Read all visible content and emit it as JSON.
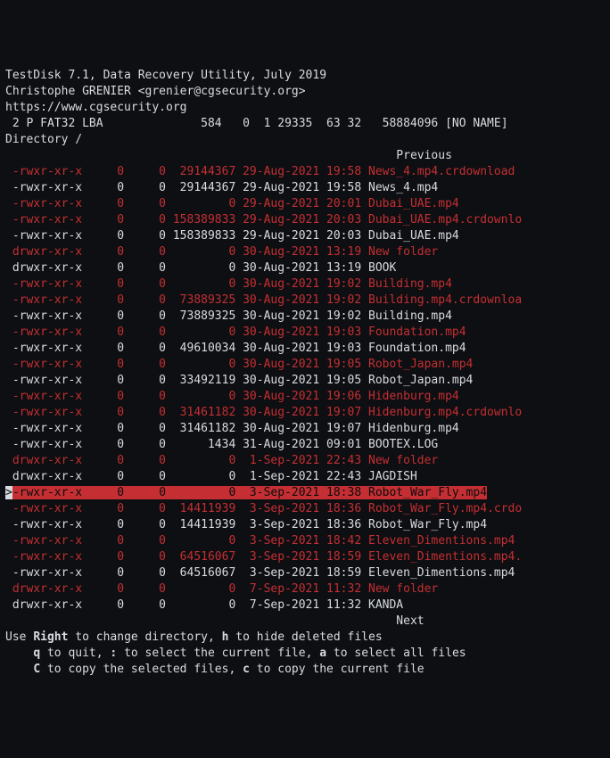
{
  "header": {
    "title": "TestDisk 7.1, Data Recovery Utility, July 2019",
    "author": "Christophe GRENIER <grenier@cgsecurity.org>",
    "url": "https://www.cgsecurity.org"
  },
  "partition": {
    "index": " 2",
    "status": "P",
    "type": "FAT32 LBA",
    "chs_start": "584",
    "chs_start_h": "0",
    "chs_start_s": "1",
    "chs_end": "29335",
    "chs_end_h": "63",
    "chs_end_s": "32",
    "sectors": "58884096",
    "label": "[NO NAME]"
  },
  "directory_label": "Directory /",
  "nav": {
    "previous": "Previous",
    "next": "Next"
  },
  "rows": [
    {
      "cls": "red",
      "perm": "-rwxr-xr-x",
      "uid": "0",
      "gid": "0",
      "size": "29144367",
      "date": "29-Aug-2021",
      "time": "19:58",
      "name": "News_4.mp4.crdownload"
    },
    {
      "cls": "white",
      "perm": "-rwxr-xr-x",
      "uid": "0",
      "gid": "0",
      "size": "29144367",
      "date": "29-Aug-2021",
      "time": "19:58",
      "name": "News_4.mp4"
    },
    {
      "cls": "red",
      "perm": "-rwxr-xr-x",
      "uid": "0",
      "gid": "0",
      "size": "0",
      "date": "29-Aug-2021",
      "time": "20:01",
      "name": "Dubai_UAE.mp4"
    },
    {
      "cls": "red",
      "perm": "-rwxr-xr-x",
      "uid": "0",
      "gid": "0",
      "size": "158389833",
      "date": "29-Aug-2021",
      "time": "20:03",
      "name": "Dubai_UAE.mp4.crdownlo"
    },
    {
      "cls": "white",
      "perm": "-rwxr-xr-x",
      "uid": "0",
      "gid": "0",
      "size": "158389833",
      "date": "29-Aug-2021",
      "time": "20:03",
      "name": "Dubai_UAE.mp4"
    },
    {
      "cls": "red",
      "perm": "drwxr-xr-x",
      "uid": "0",
      "gid": "0",
      "size": "0",
      "date": "30-Aug-2021",
      "time": "13:19",
      "name": "New folder"
    },
    {
      "cls": "white",
      "perm": "drwxr-xr-x",
      "uid": "0",
      "gid": "0",
      "size": "0",
      "date": "30-Aug-2021",
      "time": "13:19",
      "name": "BOOK"
    },
    {
      "cls": "red",
      "perm": "-rwxr-xr-x",
      "uid": "0",
      "gid": "0",
      "size": "0",
      "date": "30-Aug-2021",
      "time": "19:02",
      "name": "Building.mp4"
    },
    {
      "cls": "red",
      "perm": "-rwxr-xr-x",
      "uid": "0",
      "gid": "0",
      "size": "73889325",
      "date": "30-Aug-2021",
      "time": "19:02",
      "name": "Building.mp4.crdownloa"
    },
    {
      "cls": "white",
      "perm": "-rwxr-xr-x",
      "uid": "0",
      "gid": "0",
      "size": "73889325",
      "date": "30-Aug-2021",
      "time": "19:02",
      "name": "Building.mp4"
    },
    {
      "cls": "red",
      "perm": "-rwxr-xr-x",
      "uid": "0",
      "gid": "0",
      "size": "0",
      "date": "30-Aug-2021",
      "time": "19:03",
      "name": "Foundation.mp4"
    },
    {
      "cls": "white",
      "perm": "-rwxr-xr-x",
      "uid": "0",
      "gid": "0",
      "size": "49610034",
      "date": "30-Aug-2021",
      "time": "19:03",
      "name": "Foundation.mp4"
    },
    {
      "cls": "red",
      "perm": "-rwxr-xr-x",
      "uid": "0",
      "gid": "0",
      "size": "0",
      "date": "30-Aug-2021",
      "time": "19:05",
      "name": "Robot_Japan.mp4"
    },
    {
      "cls": "white",
      "perm": "-rwxr-xr-x",
      "uid": "0",
      "gid": "0",
      "size": "33492119",
      "date": "30-Aug-2021",
      "time": "19:05",
      "name": "Robot_Japan.mp4"
    },
    {
      "cls": "red",
      "perm": "-rwxr-xr-x",
      "uid": "0",
      "gid": "0",
      "size": "0",
      "date": "30-Aug-2021",
      "time": "19:06",
      "name": "Hidenburg.mp4"
    },
    {
      "cls": "red",
      "perm": "-rwxr-xr-x",
      "uid": "0",
      "gid": "0",
      "size": "31461182",
      "date": "30-Aug-2021",
      "time": "19:07",
      "name": "Hidenburg.mp4.crdownlo"
    },
    {
      "cls": "white",
      "perm": "-rwxr-xr-x",
      "uid": "0",
      "gid": "0",
      "size": "31461182",
      "date": "30-Aug-2021",
      "time": "19:07",
      "name": "Hidenburg.mp4"
    },
    {
      "cls": "white",
      "perm": "-rwxr-xr-x",
      "uid": "0",
      "gid": "0",
      "size": "1434",
      "date": "31-Aug-2021",
      "time": "09:01",
      "name": "BOOTEX.LOG"
    },
    {
      "cls": "red",
      "perm": "drwxr-xr-x",
      "uid": "0",
      "gid": "0",
      "size": "0",
      "date": " 1-Sep-2021",
      "time": "22:43",
      "name": "New folder"
    },
    {
      "cls": "white",
      "perm": "drwxr-xr-x",
      "uid": "0",
      "gid": "0",
      "size": "0",
      "date": " 1-Sep-2021",
      "time": "22:43",
      "name": "JAGDISH"
    },
    {
      "cls": "sel",
      "perm": "-rwxr-xr-x",
      "uid": "0",
      "gid": "0",
      "size": "0",
      "date": " 3-Sep-2021",
      "time": "18:38",
      "name": "Robot_War_Fly.mp4"
    },
    {
      "cls": "red",
      "perm": "-rwxr-xr-x",
      "uid": "0",
      "gid": "0",
      "size": "14411939",
      "date": " 3-Sep-2021",
      "time": "18:36",
      "name": "Robot_War_Fly.mp4.crdo"
    },
    {
      "cls": "white",
      "perm": "-rwxr-xr-x",
      "uid": "0",
      "gid": "0",
      "size": "14411939",
      "date": " 3-Sep-2021",
      "time": "18:36",
      "name": "Robot_War_Fly.mp4"
    },
    {
      "cls": "red",
      "perm": "-rwxr-xr-x",
      "uid": "0",
      "gid": "0",
      "size": "0",
      "date": " 3-Sep-2021",
      "time": "18:42",
      "name": "Eleven_Dimentions.mp4"
    },
    {
      "cls": "red",
      "perm": "-rwxr-xr-x",
      "uid": "0",
      "gid": "0",
      "size": "64516067",
      "date": " 3-Sep-2021",
      "time": "18:59",
      "name": "Eleven_Dimentions.mp4."
    },
    {
      "cls": "white",
      "perm": "-rwxr-xr-x",
      "uid": "0",
      "gid": "0",
      "size": "64516067",
      "date": " 3-Sep-2021",
      "time": "18:59",
      "name": "Eleven_Dimentions.mp4"
    },
    {
      "cls": "red",
      "perm": "drwxr-xr-x",
      "uid": "0",
      "gid": "0",
      "size": "0",
      "date": " 7-Sep-2021",
      "time": "11:32",
      "name": "New folder"
    },
    {
      "cls": "white",
      "perm": "drwxr-xr-x",
      "uid": "0",
      "gid": "0",
      "size": "0",
      "date": " 7-Sep-2021",
      "time": "11:32",
      "name": "KANDA"
    }
  ],
  "help": {
    "use_pre": "Use ",
    "right": "Right",
    "right_post": " to change directory, ",
    "h": "h",
    "h_post": " to hide deleted files",
    "q": "q",
    "q_post": " to quit, ",
    "colon": ":",
    "colon_post": " to select the current file, ",
    "a": "a",
    "a_post": " to select all files",
    "big_c": "C",
    "big_c_post": " to copy the selected files, ",
    "small_c": "c",
    "small_c_post": " to copy the current file"
  }
}
